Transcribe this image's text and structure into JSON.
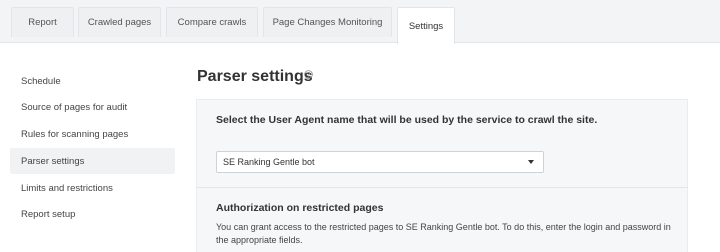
{
  "tabs": [
    {
      "label": "Report"
    },
    {
      "label": "Crawled pages"
    },
    {
      "label": "Compare crawls"
    },
    {
      "label": "Page Changes Monitoring"
    },
    {
      "label": "Settings",
      "active": true
    }
  ],
  "sidebar": {
    "items": [
      {
        "label": "Schedule"
      },
      {
        "label": "Source of pages for audit"
      },
      {
        "label": "Rules for scanning pages"
      },
      {
        "label": "Parser settings",
        "active": true
      },
      {
        "label": "Limits and restrictions"
      },
      {
        "label": "Report setup"
      }
    ]
  },
  "main": {
    "title": "Parser settings",
    "help_icon": "question-circle-icon",
    "user_agent": {
      "label": "Select the User Agent name that will be used by the service to crawl the site.",
      "selected": "SE Ranking Gentle bot"
    },
    "authorization": {
      "title": "Authorization on restricted pages",
      "description": "You can grant access to the restricted pages to SE Ranking Gentle bot. To do this, enter the login and password in the appropriate fields."
    }
  },
  "colors": {
    "tabbar_bg": "#f3f4f6",
    "panel_bg": "#f6f7f8",
    "active_item_bg": "#f1f2f4",
    "text": "#333333"
  }
}
